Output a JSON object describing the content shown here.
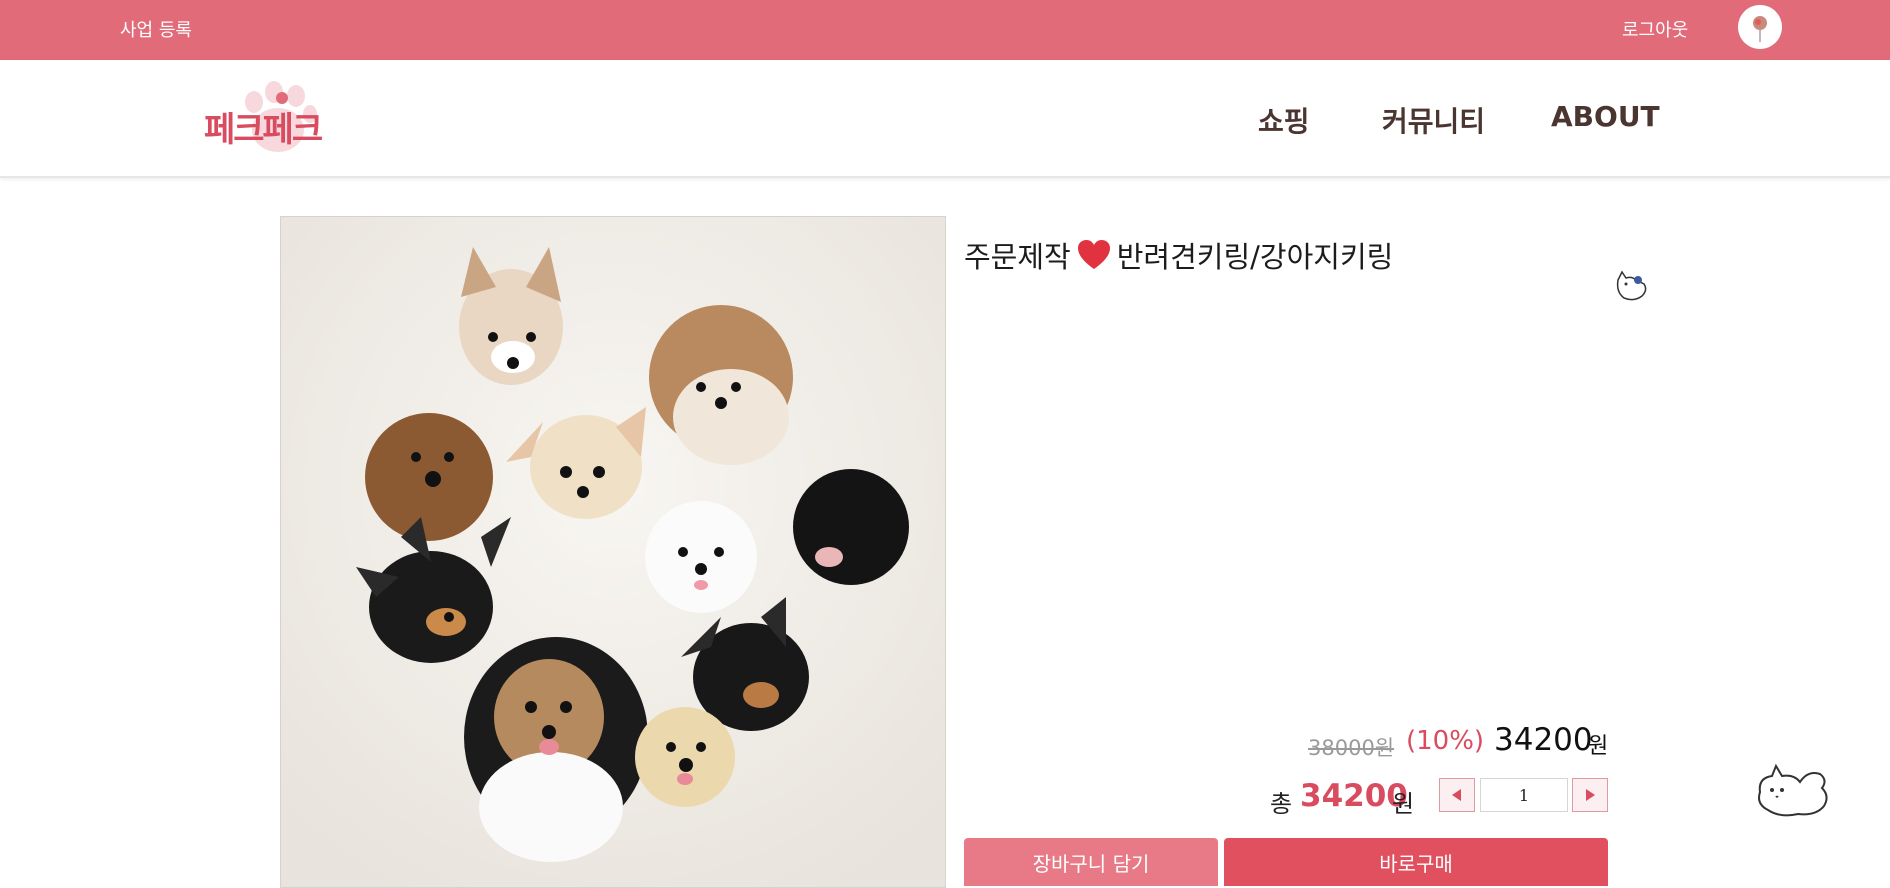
{
  "topbar": {
    "business_register": "사업 등록",
    "logout": "로그아웃",
    "bg_color": "#e26b79"
  },
  "header": {
    "logo_text": "페크페크",
    "nav": [
      "쇼핑",
      "커뮤니티",
      "ABOUT"
    ]
  },
  "product": {
    "title_prefix": "주문제작",
    "title_icon": "heart-icon",
    "title_suffix": "반려견키링/강아지키링",
    "original_price": "38000원",
    "discount": "(10%)",
    "sale_price": "34200",
    "sale_unit": "원",
    "total_label": "총",
    "total_value": "34200",
    "total_unit": "원",
    "quantity": "1"
  },
  "actions": {
    "add_to_cart": "장바구니 담기",
    "buy_now": "바로구매"
  },
  "colors": {
    "accent": "#d94b5f",
    "cart_button": "#e87a87",
    "buy_button": "#e0505f"
  }
}
